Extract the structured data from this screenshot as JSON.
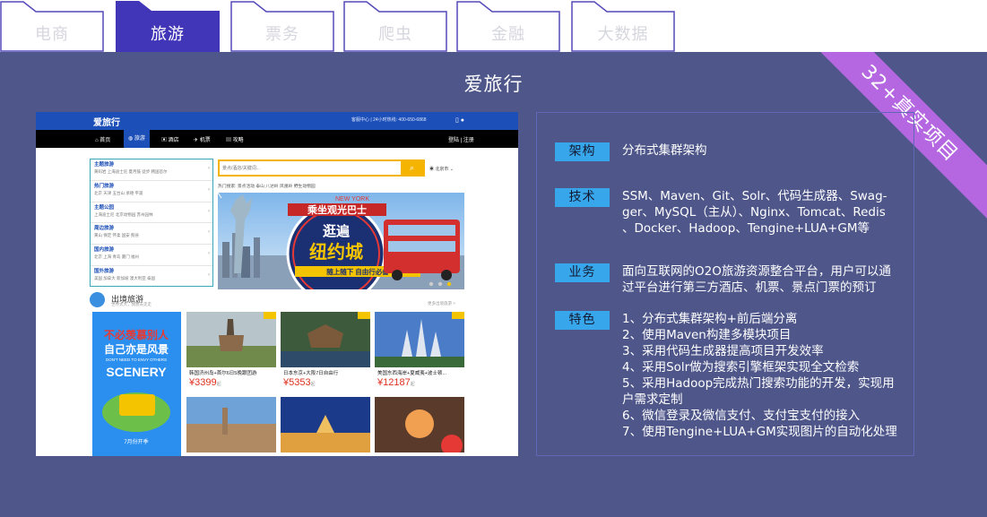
{
  "tabs": [
    {
      "label": "电商",
      "active": false
    },
    {
      "label": "旅游",
      "active": true
    },
    {
      "label": "票务",
      "active": false
    },
    {
      "label": "爬虫",
      "active": false
    },
    {
      "label": "金融",
      "active": false
    },
    {
      "label": "大数据",
      "active": false
    }
  ],
  "colors": {
    "panel_bg": "#4e568a",
    "active_tab": "#4236b8",
    "inactive_tab_border": "#5349b8",
    "label_bg": "#38a6ea",
    "ribbon": "#b467e0"
  },
  "project": {
    "title": "爱旅行",
    "ribbon": "32+真实项目"
  },
  "screenshot": {
    "logo": "爱旅行",
    "contact": "客服中心 | 24小时热线: 400-650-6868",
    "nav": [
      "首页",
      "旅游",
      "酒店",
      "机票",
      "攻略"
    ],
    "nav_active_index": 1,
    "user": "登陆 | 注册",
    "categories": [
      {
        "title": "主题旅游",
        "sub": "黄码岩  上海迪士尼  夏月鼓  徒步  韩国首尔"
      },
      {
        "title": "热门旅游",
        "sub": "北京  天津  五台山  承德  平遥"
      },
      {
        "title": "主题公园",
        "sub": "上海迪士尼  北京动物园  苏州园林"
      },
      {
        "title": "周边旅游",
        "sub": "黄山  保定  怀柔  国安  蓟县"
      },
      {
        "title": "国内旅游",
        "sub": "北京  上海  青岛  厦门  福州"
      },
      {
        "title": "国外旅游",
        "sub": "美国  加拿大  新加坡  澳大利亚  泰国"
      }
    ],
    "search_placeholder": "景点/酒店/关键词...",
    "city": "北京市",
    "hotwords": "热门搜索: 景点活动  泰山  八达岭  凤凰岭  野生动物园",
    "banner": {
      "top": "NEW YORK",
      "line1": "乘坐观光巴士",
      "line2": "逛遍",
      "line3": "纽约城",
      "line4": "随上随下 自由行必备"
    },
    "section": {
      "title": "出境旅游",
      "subtitle": "世界太大，我想去走走",
      "more": "更多出境旅游 >"
    },
    "promo": {
      "line1": "不必羡慕别人",
      "line2": "自己亦是风景",
      "line3": "DON'T NEED TO ENVY OTHERS",
      "line4": "SCENERY",
      "line5": "7月份开季"
    },
    "cards": [
      {
        "name": "韩国济州岛+首尔6日5晚跟团游",
        "price": "¥3399",
        "unit": "起"
      },
      {
        "name": "日本东京+大阪7日自由行",
        "price": "¥5353",
        "unit": "起"
      },
      {
        "name": "美国东西海岸+夏威夷+波士顿...",
        "price": "¥12187",
        "unit": "起"
      }
    ]
  },
  "details": [
    {
      "label": "架构",
      "lines": [
        "分布式集群架构"
      ]
    },
    {
      "label": "技术",
      "lines": [
        "SSM、Maven、Git、Solr、代码生成器、Swag-",
        "ger、MySQL（主从）、Nginx、Tomcat、Redis",
        "、Docker、Hadoop、Tengine+LUA+GM等"
      ]
    },
    {
      "label": "业务",
      "lines": [
        "面向互联网的O2O旅游资源整合平台，用户可以通",
        "过平台进行第三方酒店、机票、景点门票的预订"
      ]
    },
    {
      "label": "特色",
      "lines": [
        "1、分布式集群架构+前后端分离",
        "2、使用Maven构建多模块项目",
        "3、采用代码生成器提高项目开发效率",
        "4、采用Solr做为搜索引擎框架实现全文检索",
        "5、采用Hadoop完成热门搜索功能的开发，实现用",
        "户需求定制",
        "6、微信登录及微信支付、支付宝支付的接入",
        "7、使用Tengine+LUA+GM实现图片的自动化处理"
      ]
    }
  ]
}
